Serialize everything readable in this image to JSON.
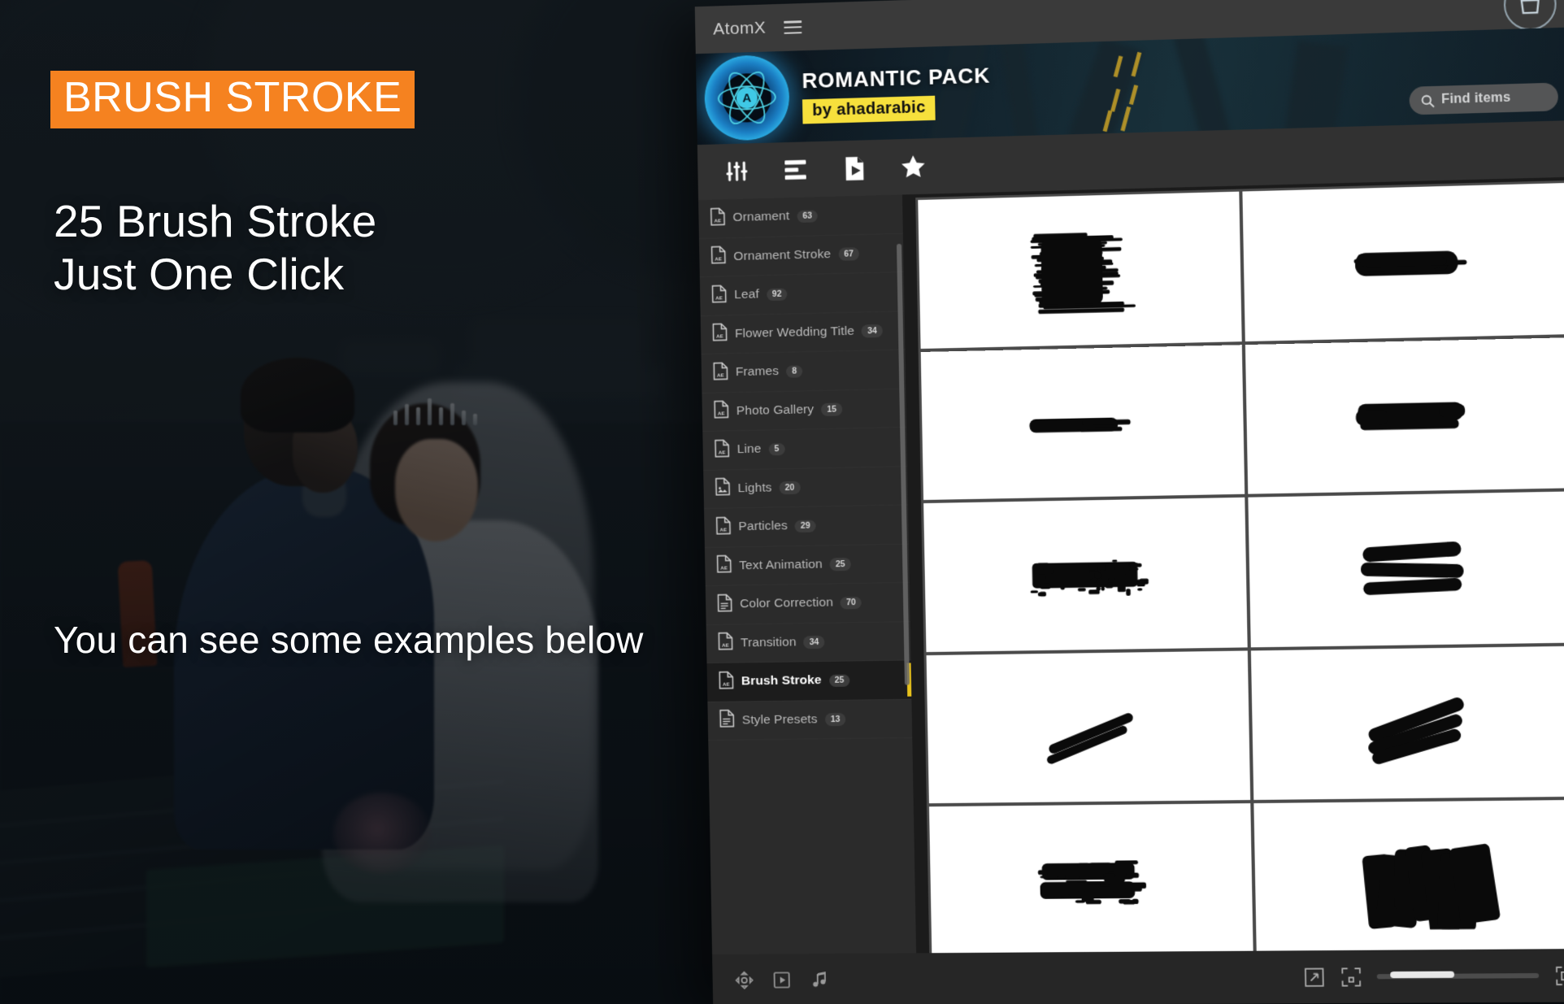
{
  "overlay": {
    "badge_title": "BRUSH STROKE",
    "headline_line1": "25 Brush Stroke",
    "headline_line2": "Just One Click",
    "subline": "You can see some examples below",
    "badge_color": "#f58220"
  },
  "panel": {
    "titlebar": {
      "app_name": "AtomX",
      "menu_icon": "hamburger-icon",
      "bag_icon": "shopping-bag-icon"
    },
    "hero": {
      "pack_title": "ROMANTIC PACK",
      "author": "by ahadarabic",
      "logo_letter": "A",
      "badge_color": "#f7e03c"
    },
    "toolbar": {
      "icons": [
        {
          "name": "sliders-icon",
          "label": "Settings"
        },
        {
          "name": "list-icon",
          "label": "List View"
        },
        {
          "name": "file-play-icon",
          "label": "Presets"
        },
        {
          "name": "star-icon",
          "label": "Favorites"
        }
      ]
    },
    "search": {
      "placeholder": "Find items",
      "value": "Find items",
      "icon": "search-icon"
    },
    "sidebar": {
      "items": [
        {
          "label": "Ornament",
          "count": "63",
          "icon": "ae-file-icon",
          "active": false
        },
        {
          "label": "Ornament Stroke",
          "count": "67",
          "icon": "ae-file-icon",
          "active": false
        },
        {
          "label": "Leaf",
          "count": "92",
          "icon": "ae-file-icon",
          "active": false
        },
        {
          "label": "Flower Wedding Title",
          "count": "34",
          "icon": "ae-file-icon",
          "active": false
        },
        {
          "label": "Frames",
          "count": "8",
          "icon": "ae-file-icon",
          "active": false
        },
        {
          "label": "Photo Gallery",
          "count": "15",
          "icon": "ae-file-icon",
          "active": false
        },
        {
          "label": "Line",
          "count": "5",
          "icon": "ae-file-icon",
          "active": false
        },
        {
          "label": "Lights",
          "count": "20",
          "icon": "image-file-icon",
          "active": false
        },
        {
          "label": "Particles",
          "count": "29",
          "icon": "ae-file-icon",
          "active": false
        },
        {
          "label": "Text Animation",
          "count": "25",
          "icon": "ae-file-icon",
          "active": false
        },
        {
          "label": "Color Correction",
          "count": "70",
          "icon": "doc-file-icon",
          "active": false
        },
        {
          "label": "Transition",
          "count": "34",
          "icon": "ae-file-icon",
          "active": false
        },
        {
          "label": "Brush Stroke",
          "count": "25",
          "icon": "ae-file-icon",
          "active": true
        },
        {
          "label": "Style Presets",
          "count": "13",
          "icon": "doc-file-icon",
          "active": false
        }
      ],
      "active_accent": "#e8c21c"
    },
    "grid": {
      "thumbnails": [
        {
          "name": "brush-stroke-thumb-1",
          "style": "dense-scribble-block"
        },
        {
          "name": "brush-stroke-thumb-2",
          "style": "thick-horizontal-bar"
        },
        {
          "name": "brush-stroke-thumb-3",
          "style": "thin-tapered-stroke"
        },
        {
          "name": "brush-stroke-thumb-4",
          "style": "layered-flat-bar"
        },
        {
          "name": "brush-stroke-thumb-5",
          "style": "rough-edged-band"
        },
        {
          "name": "brush-stroke-thumb-6",
          "style": "stacked-diagonal-slabs"
        },
        {
          "name": "brush-stroke-thumb-7",
          "style": "double-diagonal-line"
        },
        {
          "name": "brush-stroke-thumb-8",
          "style": "diagonal-crosshatch"
        },
        {
          "name": "brush-stroke-thumb-9",
          "style": "ragged-double-band"
        },
        {
          "name": "brush-stroke-thumb-10",
          "style": "heavy-angular-block"
        }
      ]
    },
    "statusbar": {
      "left_icons": [
        {
          "name": "transform-icon"
        },
        {
          "name": "video-play-icon"
        },
        {
          "name": "music-note-icon"
        }
      ],
      "right_icons": [
        {
          "name": "expand-arrows-icon"
        },
        {
          "name": "fit-small-icon"
        },
        {
          "name": "fit-large-icon"
        }
      ],
      "zoom_slider_value": "30"
    }
  }
}
